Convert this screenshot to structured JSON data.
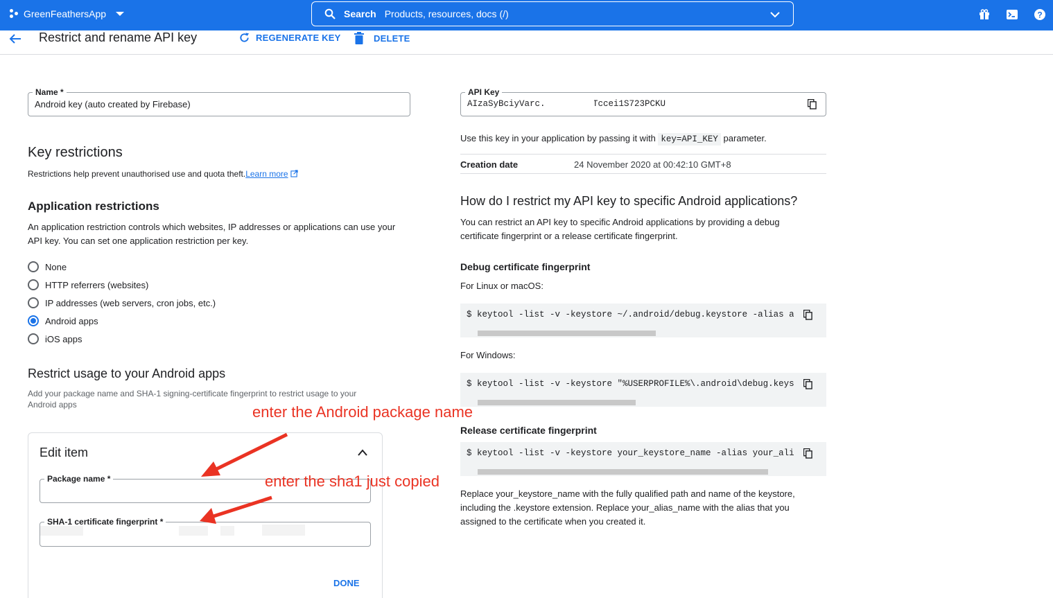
{
  "topbar": {
    "project_name": "GreenFeathersApp",
    "search_label": "Search",
    "search_placeholder": "Products, resources, docs (/)"
  },
  "header": {
    "title": "Restrict and rename API key",
    "regenerate_label": "REGENERATE KEY",
    "delete_label": "DELETE"
  },
  "name_field": {
    "label": "Name *",
    "value": "Android key (auto created by Firebase)"
  },
  "key_restrictions": {
    "heading": "Key restrictions",
    "description": "Restrictions help prevent unauthorised use and quota theft.",
    "learn_more": "Learn more"
  },
  "app_restrictions": {
    "heading": "Application restrictions",
    "description": "An application restriction controls which websites, IP addresses or applications can use your API key. You can set one application restriction per key.",
    "options": [
      {
        "label": "None",
        "selected": false
      },
      {
        "label": "HTTP referrers (websites)",
        "selected": false
      },
      {
        "label": "IP addresses (web servers, cron jobs, etc.)",
        "selected": false
      },
      {
        "label": "Android apps",
        "selected": true
      },
      {
        "label": "iOS apps",
        "selected": false
      }
    ]
  },
  "restrict_usage": {
    "heading": "Restrict usage to your Android apps",
    "description": "Add your package name and SHA-1 signing-certificate fingerprint to restrict usage to your Android apps"
  },
  "edit_item": {
    "title": "Edit item",
    "package_label": "Package name *",
    "sha1_label": "SHA-1 certificate fingerprint *",
    "done_label": "DONE"
  },
  "api_key": {
    "label": "API Key",
    "value_start": "AIzaSyBciyVarc.",
    "value_end": "7_Tccei1S723PCKU",
    "usage_prefix": "Use this key in your application by passing it with ",
    "usage_code": "key=API_KEY",
    "usage_suffix": " parameter.",
    "creation_label": "Creation date",
    "creation_value": "24 November 2020 at 00:42:10 GMT+8"
  },
  "help": {
    "heading": "How do I restrict my API key to specific Android applications?",
    "intro": "You can restrict an API key to specific Android applications by providing a debug certificate fingerprint or a release certificate fingerprint.",
    "debug_heading": "Debug certificate fingerprint",
    "linux_label": "For Linux or macOS:",
    "linux_cmd": "$  keytool -list -v -keystore ~/.android/debug.keystore -alias androiddebugkey",
    "windows_label": "For Windows:",
    "windows_cmd": "$  keytool -list -v -keystore \"%USERPROFILE%\\.android\\debug.keystore\" -alias",
    "release_heading": "Release certificate fingerprint",
    "release_cmd": "$  keytool -list -v -keystore your_keystore_name -alias your_alias_name",
    "outro": "Replace your_keystore_name with the fully qualified path and name of the keystore, including the .keystore extension. Replace your_alias_name with the alias that you assigned to the certificate when you created it."
  },
  "annotations": {
    "package_hint": "enter the Android package name",
    "sha1_hint": "enter the sha1 just copied"
  },
  "colors": {
    "brand": "#1a73e8",
    "annotation": "#ea3323"
  }
}
